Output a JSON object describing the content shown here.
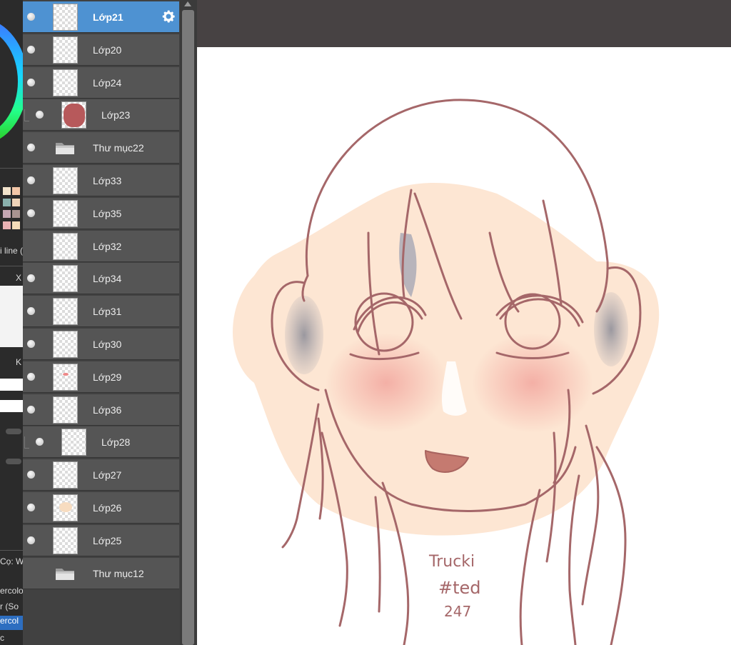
{
  "left_strip": {
    "texts": [
      "i line (",
      "X",
      "K",
      "Cọ: W",
      "ercolo",
      "r (So",
      "ercol",
      "c"
    ],
    "swatch_colors": [
      "#f2e3cc",
      "#f3c7a8",
      "#8ab1ad",
      "#efd4b8",
      "#c4a6b2",
      "#a99491",
      "#e9b2b4",
      "#f6dcb9"
    ]
  },
  "layers": [
    {
      "name": "Lớp21",
      "selected": true,
      "clipped": false,
      "kind": "layer",
      "visible": true
    },
    {
      "name": "Lớp20",
      "selected": false,
      "clipped": false,
      "kind": "layer",
      "visible": true
    },
    {
      "name": "Lớp24",
      "selected": false,
      "clipped": false,
      "kind": "layer",
      "visible": true
    },
    {
      "name": "Lớp23",
      "selected": false,
      "clipped": true,
      "kind": "layer",
      "visible": true
    },
    {
      "name": "Thư mục22",
      "selected": false,
      "clipped": false,
      "kind": "folder",
      "visible": true
    },
    {
      "name": "Lớp33",
      "selected": false,
      "clipped": false,
      "kind": "layer",
      "visible": true
    },
    {
      "name": "Lớp35",
      "selected": false,
      "clipped": false,
      "kind": "layer",
      "visible": true
    },
    {
      "name": "Lớp32",
      "selected": false,
      "clipped": false,
      "kind": "layer",
      "visible": false
    },
    {
      "name": "Lớp34",
      "selected": false,
      "clipped": false,
      "kind": "layer",
      "visible": true
    },
    {
      "name": "Lớp31",
      "selected": false,
      "clipped": false,
      "kind": "layer",
      "visible": true
    },
    {
      "name": "Lớp30",
      "selected": false,
      "clipped": false,
      "kind": "layer",
      "visible": true
    },
    {
      "name": "Lớp29",
      "selected": false,
      "clipped": false,
      "kind": "layer",
      "visible": true
    },
    {
      "name": "Lớp36",
      "selected": false,
      "clipped": false,
      "kind": "layer",
      "visible": true
    },
    {
      "name": "Lớp28",
      "selected": false,
      "clipped": true,
      "kind": "layer",
      "visible": true
    },
    {
      "name": "Lớp27",
      "selected": false,
      "clipped": false,
      "kind": "layer",
      "visible": true
    },
    {
      "name": "Lớp26",
      "selected": false,
      "clipped": false,
      "kind": "layer",
      "visible": true
    },
    {
      "name": "Lớp25",
      "selected": false,
      "clipped": false,
      "kind": "layer",
      "visible": true
    },
    {
      "name": "Thư mục12",
      "selected": false,
      "clipped": false,
      "kind": "folder",
      "visible": false
    }
  ],
  "icons": {
    "settings": "gear-icon",
    "folder": "folder-icon",
    "visibility": "eye-dot-icon",
    "scroll_up": "arrow-up-icon"
  },
  "colors": {
    "selected_row": "#4e92d2",
    "row": "#555555",
    "panel_bg": "#414141",
    "app_bg": "#474243",
    "line_art": "#a56769",
    "skin": "#fde5d2",
    "blush": "#f2b0a9"
  },
  "canvas": {
    "signature": [
      "Trucki",
      "#ted",
      "247"
    ]
  }
}
